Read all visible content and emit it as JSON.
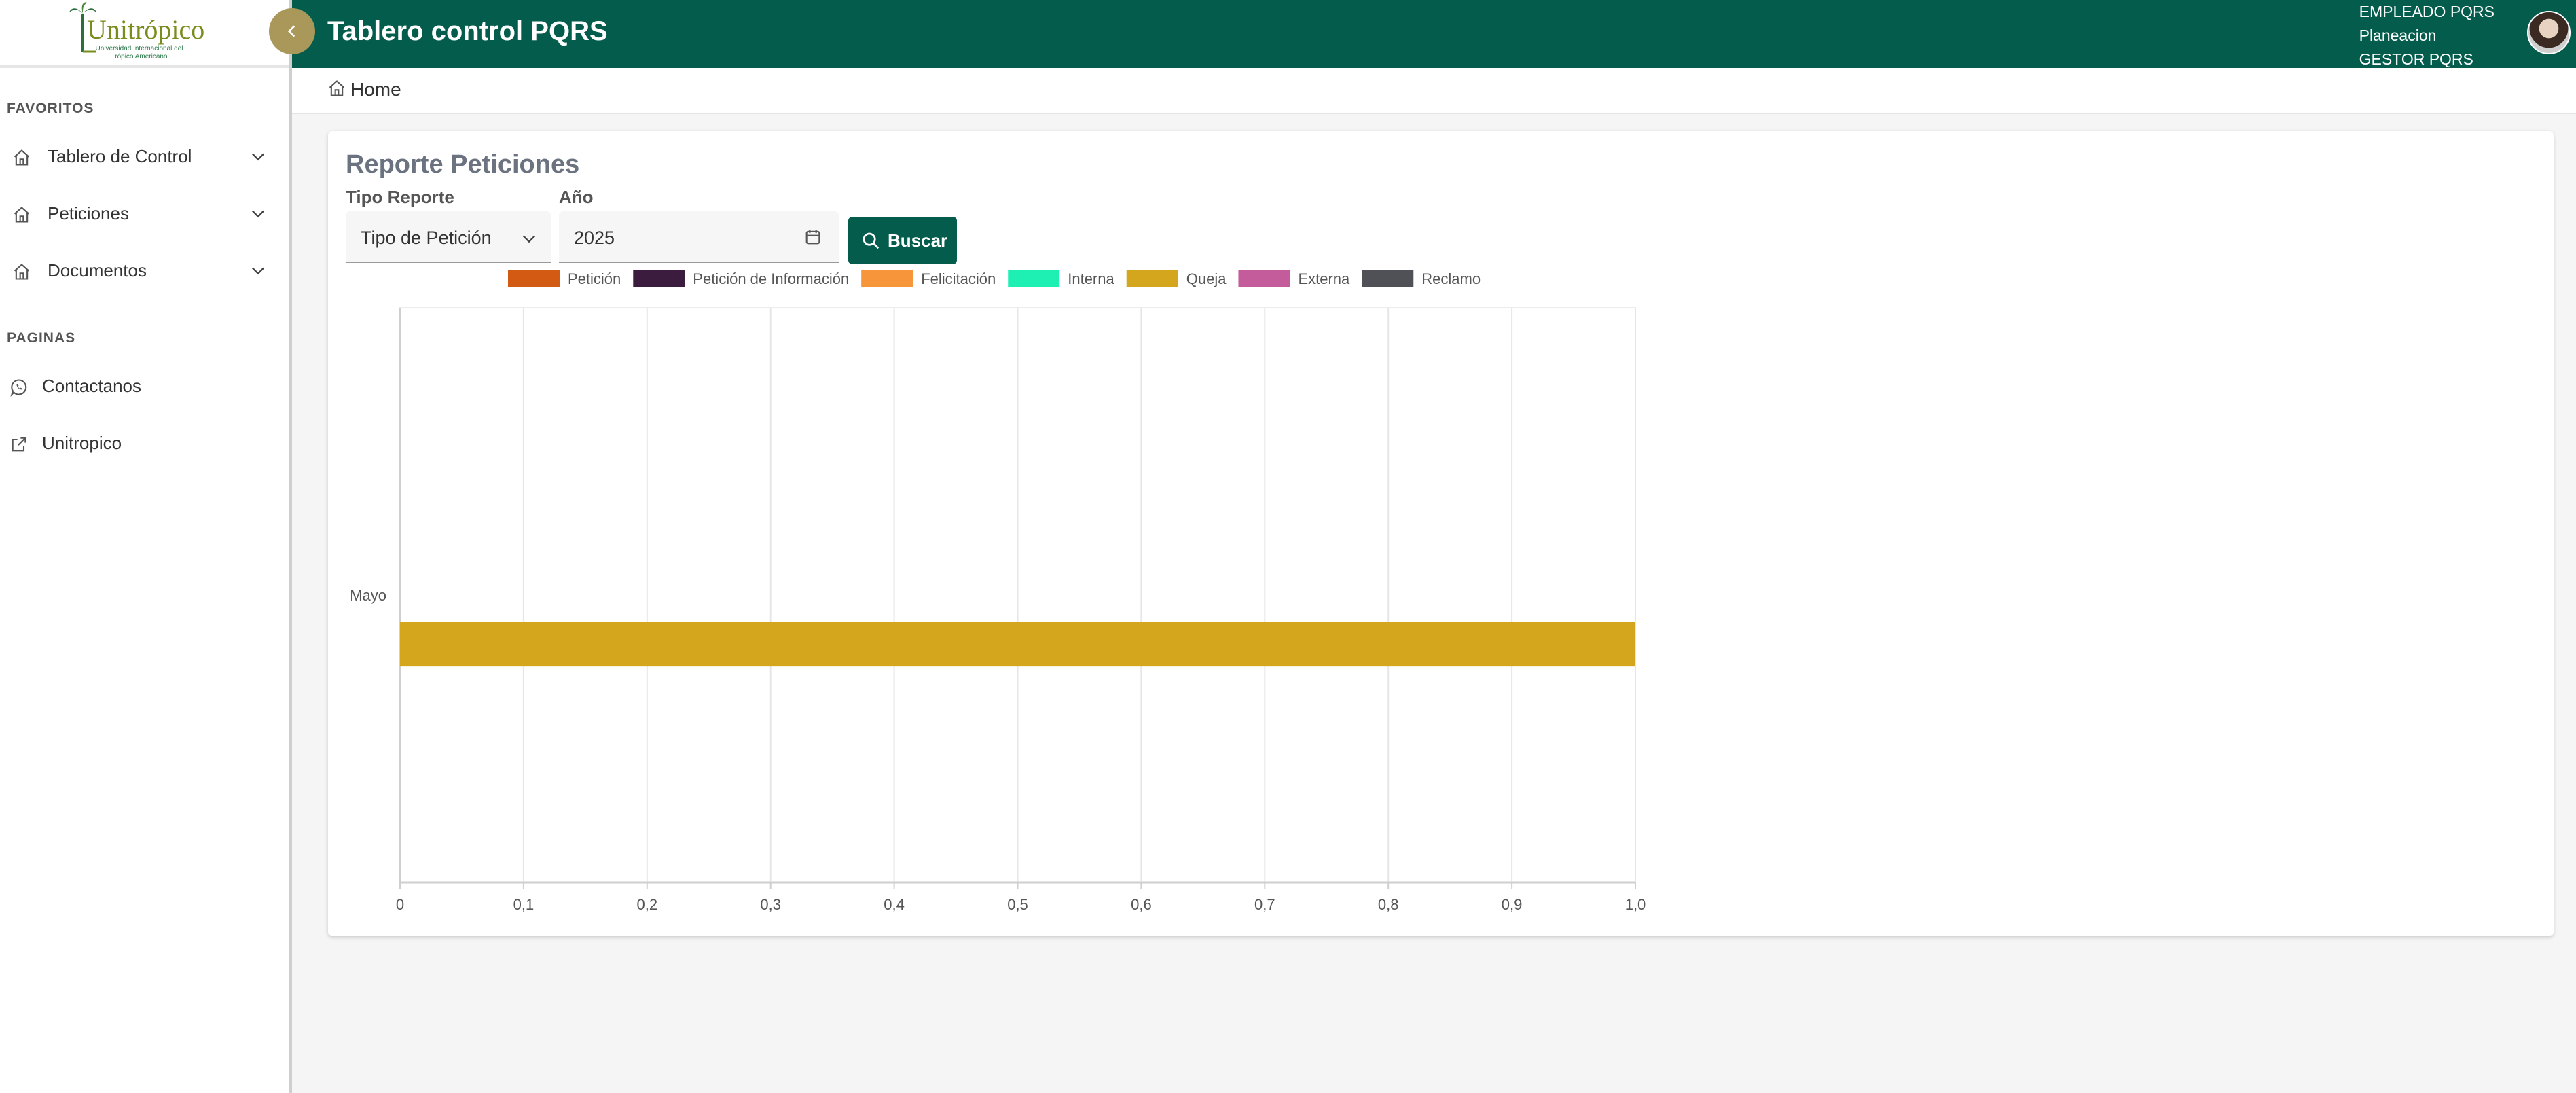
{
  "app": {
    "logo_text": "Unitrópico",
    "logo_subtitle": "Universidad Internacional del Trópico Americano",
    "title": "Tablero control PQRS"
  },
  "user": {
    "lines": [
      "EMPLEADO PQRS",
      "Planeacion",
      "GESTOR PQRS"
    ]
  },
  "sidebar": {
    "favorites_label": "FAVORITOS",
    "favorites": [
      {
        "label": "Tablero de Control",
        "icon": "home-icon"
      },
      {
        "label": "Peticiones",
        "icon": "home-icon"
      },
      {
        "label": "Documentos",
        "icon": "home-icon"
      }
    ],
    "pages_label": "PAGINAS",
    "pages": [
      {
        "label": "Contactanos",
        "icon": "whatsapp-icon"
      },
      {
        "label": "Unitropico",
        "icon": "external-link-icon"
      }
    ]
  },
  "breadcrumb": {
    "home": "Home"
  },
  "report": {
    "title": "Reporte Peticiones",
    "type_label": "Tipo Reporte",
    "type_value": "Tipo de Petición",
    "year_label": "Año",
    "year_value": "2025",
    "search_label": "Buscar"
  },
  "colors": {
    "header": "#045c4c",
    "accent": "#a99859",
    "button": "#045c4c"
  },
  "chart_data": {
    "type": "bar",
    "orientation": "horizontal",
    "categories": [
      "Mayo"
    ],
    "series": [
      {
        "name": "Petición",
        "color": "#d35a12",
        "values": [
          0
        ]
      },
      {
        "name": "Petición de Información",
        "color": "#3c1c3e",
        "values": [
          0
        ]
      },
      {
        "name": "Felicitación",
        "color": "#f7953a",
        "values": [
          0
        ]
      },
      {
        "name": "Interna",
        "color": "#1ef0b4",
        "values": [
          0
        ]
      },
      {
        "name": "Queja",
        "color": "#d3a61e",
        "values": [
          1
        ]
      },
      {
        "name": "Externa",
        "color": "#c45c9c",
        "values": [
          0
        ]
      },
      {
        "name": "Reclamo",
        "color": "#4f5156",
        "values": [
          0
        ]
      }
    ],
    "xlim": [
      0,
      1
    ],
    "xticks": [
      "0",
      "0,1",
      "0,2",
      "0,3",
      "0,4",
      "0,5",
      "0,6",
      "0,7",
      "0,8",
      "0,9",
      "1,0"
    ],
    "grid": true,
    "legend_position": "top"
  }
}
